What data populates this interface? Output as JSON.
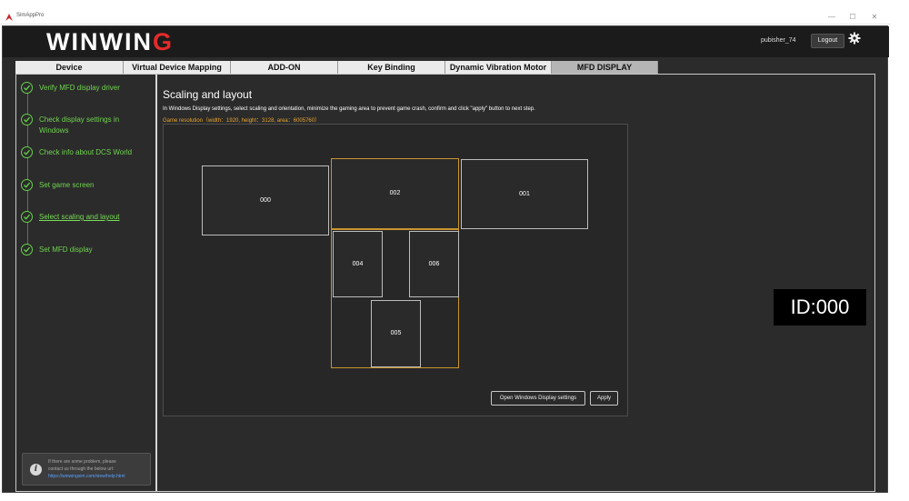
{
  "titlebar": {
    "title": "SimAppPro",
    "minimize": "—",
    "maximize": "☐",
    "close": "✕"
  },
  "header": {
    "brand_main": "WINWIN",
    "brand_accent": "G",
    "username": "pubisher_74",
    "logout_label": "Logout"
  },
  "tabs": [
    {
      "label": "Device",
      "active": false
    },
    {
      "label": "Virtual Device Mapping",
      "active": false
    },
    {
      "label": "ADD-ON",
      "active": false
    },
    {
      "label": "Key Binding",
      "active": false
    },
    {
      "label": "Dynamic Vibration Motor",
      "active": false
    },
    {
      "label": "MFD DISPLAY",
      "active": true
    }
  ],
  "steps": [
    {
      "label": "Verify MFD display driver",
      "current": false
    },
    {
      "label": "Check display settings in Windows",
      "current": false
    },
    {
      "label": "Check info about DCS World",
      "current": false
    },
    {
      "label": "Set game screen",
      "current": false
    },
    {
      "label": "Select scaling and layout",
      "current": true
    },
    {
      "label": "Set MFD display",
      "current": false
    }
  ],
  "help": {
    "line1": "If there are some problem, please",
    "line2": "contact us through the below url:",
    "link": "https://winwingsim.com/view/help.html"
  },
  "main": {
    "title": "Scaling and layout",
    "description": "In Windows Display settings, select scaling and orientation, minimize the gaming area to prevent game crash, confirm and click \"apply\" button to next step.",
    "resolution": "Game resolution（width：1920,   height：3128,   area：6005760）",
    "open_settings_label": "Open Windows Display settings",
    "apply_label": "Apply"
  },
  "monitors": [
    {
      "id": "000",
      "selected": false
    },
    {
      "id": "002",
      "selected": true
    },
    {
      "id": "001",
      "selected": false
    },
    {
      "id": "004",
      "selected": false
    },
    {
      "id": "006",
      "selected": false
    },
    {
      "id": "005",
      "selected": false
    }
  ],
  "id_badge": "ID:000",
  "colors": {
    "accent_green": "#6fd34e",
    "accent_orange": "#c9952d",
    "brand_red": "#e32b2b"
  }
}
